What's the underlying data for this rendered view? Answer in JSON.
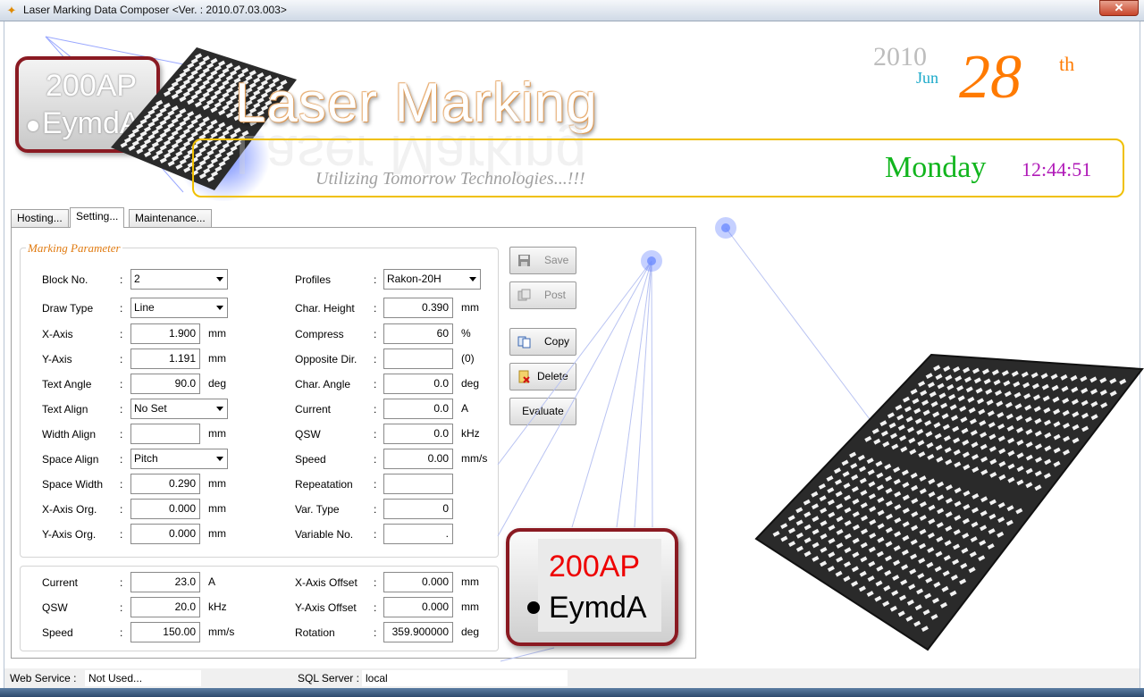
{
  "window": {
    "title": "Laser Marking Data Composer <Ver. : 2010.07.03.003>",
    "app_icon": "laser-icon",
    "close_label": "✕"
  },
  "header": {
    "logo_line1": "200AP",
    "logo_line2": "EymdA",
    "title": "Laser Marking",
    "tagline": "Utilizing Tomorrow Technologies...!!!",
    "year": "2010",
    "month": "Jun",
    "day": "28",
    "day_suffix": "th",
    "weekday": "Monday",
    "time": "12:44:51",
    "colors": {
      "day": "#ff7a00",
      "weekday": "#11b51d",
      "time": "#b01ab8",
      "month": "#1aa9c9",
      "banner_border": "#f0c000",
      "logo_border": "#8a1a22"
    }
  },
  "tabs": [
    {
      "label": "Hosting..."
    },
    {
      "label": "Setting..."
    },
    {
      "label": "Maintenance..."
    }
  ],
  "active_tab": "Setting...",
  "marking": {
    "group_title": "Marking Parameter",
    "left": [
      {
        "label": "Block No.",
        "type": "select",
        "value": "2",
        "unit": ""
      },
      {
        "label": "Draw Type",
        "type": "select",
        "value": "Line",
        "unit": ""
      },
      {
        "label": "X-Axis",
        "type": "input",
        "value": "1.900",
        "unit": "mm"
      },
      {
        "label": "Y-Axis",
        "type": "input",
        "value": "1.191",
        "unit": "mm"
      },
      {
        "label": "Text Angle",
        "type": "input",
        "value": "90.0",
        "unit": "deg"
      },
      {
        "label": "Text Align",
        "type": "select",
        "value": "No Set",
        "unit": ""
      },
      {
        "label": "Width Align",
        "type": "input",
        "value": "",
        "unit": "mm"
      },
      {
        "label": "Space Align",
        "type": "select",
        "value": "Pitch",
        "unit": ""
      },
      {
        "label": "Space Width",
        "type": "input",
        "value": "0.290",
        "unit": "mm"
      },
      {
        "label": "X-Axis Org.",
        "type": "input",
        "value": "0.000",
        "unit": "mm"
      },
      {
        "label": "Y-Axis Org.",
        "type": "input",
        "value": "0.000",
        "unit": "mm"
      }
    ],
    "right": [
      {
        "label": "Profiles",
        "type": "select",
        "value": "Rakon-20H",
        "unit": ""
      },
      {
        "label": "Char. Height",
        "type": "input",
        "value": "0.390",
        "unit": "mm"
      },
      {
        "label": "Compress",
        "type": "input",
        "value": "60",
        "unit": "%"
      },
      {
        "label": "Opposite Dir.",
        "type": "input",
        "value": "",
        "unit": "(0)"
      },
      {
        "label": "Char. Angle",
        "type": "input",
        "value": "0.0",
        "unit": "deg"
      },
      {
        "label": "Current",
        "type": "input",
        "value": "0.0",
        "unit": "A"
      },
      {
        "label": "QSW",
        "type": "input",
        "value": "0.0",
        "unit": "kHz"
      },
      {
        "label": "Speed",
        "type": "input",
        "value": "0.00",
        "unit": "mm/s"
      },
      {
        "label": "Repeatation",
        "type": "input",
        "value": "",
        "unit": ""
      },
      {
        "label": "Var. Type",
        "type": "input",
        "value": "0",
        "unit": ""
      },
      {
        "label": "Variable No.",
        "type": "input",
        "value": ".",
        "unit": ""
      }
    ]
  },
  "laser": {
    "left": [
      {
        "label": "Current",
        "value": "23.0",
        "unit": "A"
      },
      {
        "label": "QSW",
        "value": "20.0",
        "unit": "kHz"
      },
      {
        "label": "Speed",
        "value": "150.00",
        "unit": "mm/s"
      }
    ],
    "right": [
      {
        "label": "X-Axis Offset",
        "value": "0.000",
        "unit": "mm"
      },
      {
        "label": "Y-Axis Offset",
        "value": "0.000",
        "unit": "mm"
      },
      {
        "label": "Rotation",
        "value": "359.900000",
        "unit": "deg"
      }
    ]
  },
  "buttons": {
    "save": {
      "label": "Save",
      "icon": "floppy-disk-icon"
    },
    "post": {
      "label": "Post",
      "icon": "post-icon"
    },
    "copy": {
      "label": "Copy",
      "icon": "copy-icon"
    },
    "delete": {
      "label": "Delete",
      "icon": "delete-icon"
    },
    "evaluate": {
      "label": "Evaluate"
    }
  },
  "big_logo": {
    "line1": "200AP",
    "line2": "EymdA"
  },
  "status": {
    "web_label": "Web Service :",
    "web_value": "Not Used...",
    "sql_label": "SQL Server :",
    "sql_value": "local"
  }
}
